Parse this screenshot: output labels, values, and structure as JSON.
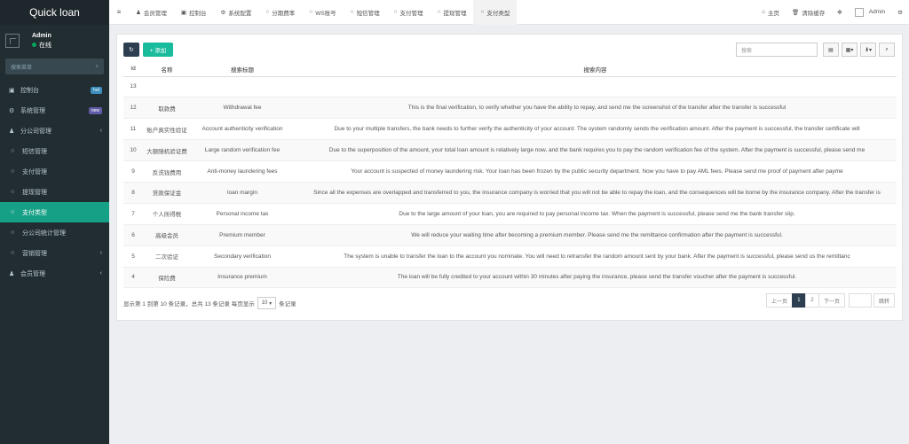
{
  "sidebar": {
    "brand": "Quick loan",
    "user": {
      "name": "Admin",
      "status": "在线"
    },
    "search_placeholder": "搜索菜单",
    "items": [
      {
        "icon": "dashboard-icon",
        "glyph": "▣",
        "label": "控制台",
        "badge": "hot",
        "badge_type": "hot"
      },
      {
        "icon": "gears-icon",
        "glyph": "⚙",
        "label": "系统管理",
        "badge": "new",
        "badge_type": "new"
      },
      {
        "icon": "user-icon",
        "glyph": "♟",
        "label": "分公司管理",
        "chevron": "‹"
      },
      {
        "icon": "circle-icon",
        "glyph": "○",
        "label": "短信管理"
      },
      {
        "icon": "circle-icon",
        "glyph": "○",
        "label": "支付管理"
      },
      {
        "icon": "circle-icon",
        "glyph": "○",
        "label": "提现管理"
      },
      {
        "icon": "circle-icon",
        "glyph": "○",
        "label": "支付类型",
        "active": true
      },
      {
        "icon": "circle-icon",
        "glyph": "○",
        "label": "分公司统计管理"
      },
      {
        "icon": "circle-icon",
        "glyph": "○",
        "label": "营销管理",
        "chevron": "‹"
      },
      {
        "icon": "users-icon",
        "glyph": "♟",
        "label": "会员管理",
        "chevron": "‹"
      }
    ]
  },
  "topbar": {
    "toggle": "≡",
    "tabs": [
      {
        "icon": "user-icon",
        "glyph": "♟",
        "label": "会员管理"
      },
      {
        "icon": "dashboard-icon",
        "glyph": "▣",
        "label": "控制台"
      },
      {
        "icon": "gears-icon",
        "glyph": "⚙",
        "label": "系统配置"
      },
      {
        "icon": "circle-icon",
        "glyph": "○",
        "label": "分期费率"
      },
      {
        "icon": "circle-icon",
        "glyph": "○",
        "label": "WS账号"
      },
      {
        "icon": "circle-icon",
        "glyph": "○",
        "label": "短信管理"
      },
      {
        "icon": "circle-icon",
        "glyph": "○",
        "label": "支付管理"
      },
      {
        "icon": "circle-icon",
        "glyph": "○",
        "label": "提现管理"
      },
      {
        "icon": "circle-icon",
        "glyph": "○",
        "label": "支付类型",
        "active": true
      }
    ],
    "home": "主页",
    "clear_cache": "清除缓存",
    "fullscreen_glyph": "✥",
    "admin": "Admin",
    "settings_glyph": "⚙"
  },
  "toolbar": {
    "refresh_glyph": "↻",
    "add_label": "+ 添加",
    "search_placeholder": "搜索",
    "table_glyph": "▤",
    "columns_glyph": "▦▾",
    "export_glyph": "⬇▾",
    "search_glyph": "⌕"
  },
  "table": {
    "headers": [
      "Id",
      "名称",
      "搜索标题",
      "搜索内容"
    ],
    "rows": [
      {
        "id": "13",
        "name": "",
        "title": "",
        "content": ""
      },
      {
        "id": "12",
        "name": "取款费",
        "title": "Withdrawal fee",
        "content": "This is the final verification, to verify whether you have the ability to repay, and send me the screenshot of the transfer after the transfer is successful"
      },
      {
        "id": "11",
        "name": "账户真实性验证",
        "title": "Account authenticity verification",
        "content": "Due to your multiple transfers, the bank needs to further verify the authenticity of your account. The system randomly sends the verification amount. After the payment is successful, the transfer certificate will"
      },
      {
        "id": "10",
        "name": "大额随机验证费",
        "title": "Large random verification fee",
        "content": "Due to the superposition of the amount, your total loan amount is relatively large now, and the bank requires you to pay the random verification fee of the system. After the payment is successful, please send me"
      },
      {
        "id": "9",
        "name": "反洗钱费用",
        "title": "Anti-money laundering fees",
        "content": "Your account is suspected of money laundering risk. Your loan has been frozen by the public security department. Now you have to pay AML fees. Please send me proof of payment after payme"
      },
      {
        "id": "8",
        "name": "贷款保证金",
        "title": "loan margin",
        "content": "Since all the expenses are overlapped and transferred to you, the insurance company is worried that you will not be able to repay the loan, and the consequences will be borne by the insurance company. After the transfer is"
      },
      {
        "id": "7",
        "name": "个人所得税",
        "title": "Personal income tax",
        "content": "Due to the large amount of your loan, you are required to pay personal income tax. When the payment is successful, please send me the bank transfer slip."
      },
      {
        "id": "6",
        "name": "高级会员",
        "title": "Premium member",
        "content": "We will reduce your waiting time after becoming a premium member. Please send me the remittance confirmation after the payment is successful."
      },
      {
        "id": "5",
        "name": "二次验证",
        "title": "Secondary verification",
        "content": "The system is unable to transfer the loan to the account you nominate. You will need to retransfer the random amount sent by your bank. After the payment is successful, please send us the remittanc"
      },
      {
        "id": "4",
        "name": "保险费",
        "title": "Insurance premium",
        "content": "The loan will be fully credited to your account within 30 minutes after paying the insurance, please send the transfer voucher after the payment is successful."
      }
    ]
  },
  "pager": {
    "info_prefix": "显示第 1 到第 10 条记录，总共 13 条记录 每页显示",
    "page_size": "10",
    "info_suffix": "条记录",
    "prev": "上一页",
    "pages": [
      "1",
      "2"
    ],
    "current": "1",
    "next": "下一页",
    "go": "跳转"
  }
}
